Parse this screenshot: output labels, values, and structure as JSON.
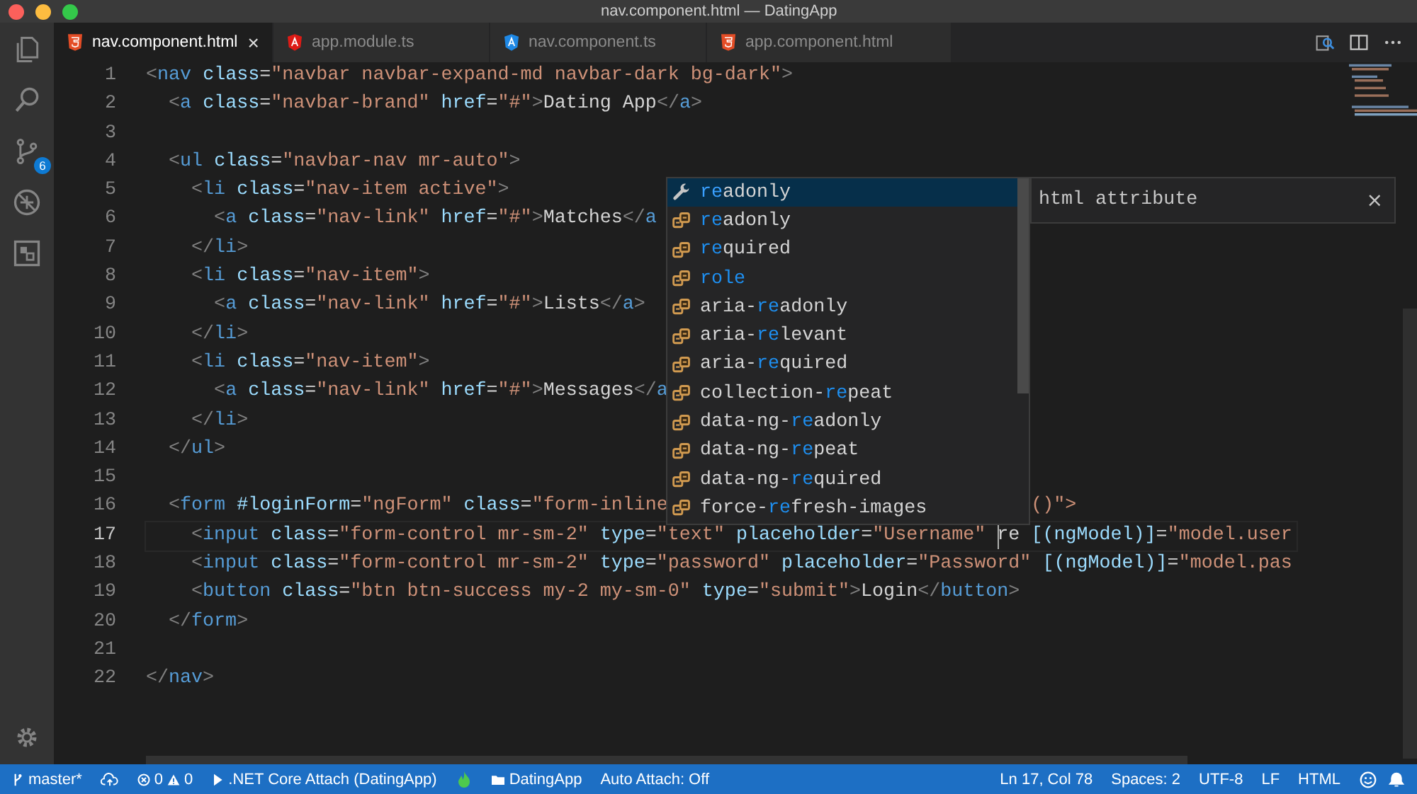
{
  "window": {
    "title": "nav.component.html — DatingApp"
  },
  "activity_bar": {
    "source_control_badge": "6"
  },
  "tabs": [
    {
      "label": "nav.component.html",
      "kind": "html",
      "color": "#e44d26",
      "selected": true,
      "close": "×"
    },
    {
      "label": "app.module.ts",
      "kind": "angular",
      "color": "#dd1b16",
      "selected": false
    },
    {
      "label": "nav.component.ts",
      "kind": "angular",
      "color": "#1e88e5",
      "selected": false
    },
    {
      "label": "app.component.html",
      "kind": "html",
      "color": "#e44d26",
      "selected": false
    }
  ],
  "editor": {
    "lines": [
      {
        "number": "1",
        "text": "<nav class=\"navbar navbar-expand-md navbar-dark bg-dark\">"
      },
      {
        "number": "2",
        "text": "  <a class=\"navbar-brand\" href=\"#\">Dating App</a>"
      },
      {
        "number": "3"
      },
      {
        "number": "4",
        "text": "  <ul class=\"navbar-nav mr-auto\">"
      },
      {
        "number": "5",
        "text": "    <li class=\"nav-item active\">"
      },
      {
        "number": "6",
        "text": "      <a class=\"nav-link\" href=\"#\">Matches</a"
      },
      {
        "number": "7",
        "text": "    </li>"
      },
      {
        "number": "8",
        "text": "    <li class=\"nav-item\">"
      },
      {
        "number": "9",
        "text": "      <a class=\"nav-link\" href=\"#\">Lists</a>"
      },
      {
        "number": "10",
        "text": "    </li>"
      },
      {
        "number": "11",
        "text": "    <li class=\"nav-item\">"
      },
      {
        "number": "12",
        "text": "      <a class=\"nav-link\" href=\"#\">Messages</a"
      },
      {
        "number": "13",
        "text": "    </li>"
      },
      {
        "number": "14",
        "text": "  </ul>"
      },
      {
        "number": "15"
      },
      {
        "number": "16",
        "text": "  <form #loginForm=\"ngForm\" class=\"form-inline",
        "tail": "()\">"
      },
      {
        "number": "17",
        "current": true,
        "text": "    <input class=\"form-control mr-sm-2\" type=\"text\" placeholder=\"Username\" re [(ngModel)]=\"model.user"
      },
      {
        "number": "18",
        "text": "    <input class=\"form-control mr-sm-2\" type=\"password\" placeholder=\"Password\" [(ngModel)]=\"model.pas"
      },
      {
        "number": "19",
        "text": "    <button class=\"btn btn-success my-2 my-sm-0\" type=\"submit\">Login</button>"
      },
      {
        "number": "20",
        "text": "  </form>"
      },
      {
        "number": "21"
      },
      {
        "number": "22",
        "text": "</nav>"
      }
    ]
  },
  "suggestions": [
    {
      "label": "**re**adonly",
      "kind": "snippet",
      "selected": true
    },
    {
      "label": "**re**adonly",
      "kind": "property",
      "selected": false
    },
    {
      "label": "**re**quired",
      "kind": "property",
      "selected": false
    },
    {
      "label": "**role**",
      "kind": "property",
      "selected": false
    },
    {
      "label": "aria-**re**adonly",
      "kind": "property",
      "selected": false
    },
    {
      "label": "aria-**re**levant",
      "kind": "property",
      "selected": false
    },
    {
      "label": "aria-**re**quired",
      "kind": "property",
      "selected": false
    },
    {
      "label": "collection-**re**peat",
      "kind": "property",
      "selected": false
    },
    {
      "label": "data-ng-**re**adonly",
      "kind": "property",
      "selected": false
    },
    {
      "label": "data-ng-**re**peat",
      "kind": "property",
      "selected": false
    },
    {
      "label": "data-ng-**re**quired",
      "kind": "property",
      "selected": false
    },
    {
      "label": "force-**re**fresh-images",
      "kind": "property",
      "selected": false
    }
  ],
  "suggestion_details": {
    "text": "html attribute",
    "close": "×"
  },
  "status_bar": {
    "branch": "master*",
    "errors": "0",
    "warnings": "0",
    "debug_config": ".NET Core Attach (DatingApp)",
    "folder": "DatingApp",
    "auto_attach": "Auto Attach: Off",
    "position": "Ln 17, Col 78",
    "spaces": "Spaces: 2",
    "encoding": "UTF-8",
    "eol": "LF",
    "language": "HTML"
  }
}
